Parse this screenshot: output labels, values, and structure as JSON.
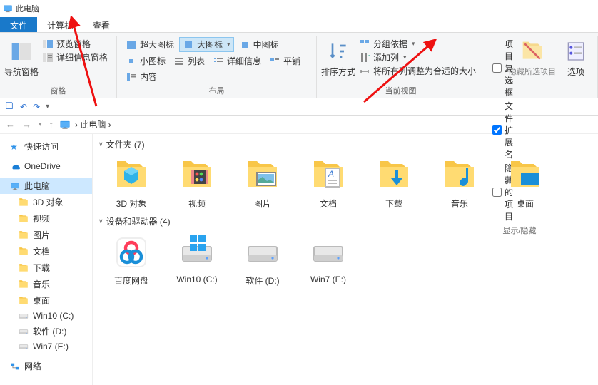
{
  "titlebar": {
    "title": "此电脑"
  },
  "tabs": {
    "file": "文件",
    "computer": "计算机",
    "view": "查看"
  },
  "ribbon": {
    "groups": {
      "panes": {
        "label": "窗格",
        "nav": "导航窗格",
        "preview": "预览窗格",
        "details": "详细信息窗格"
      },
      "layout": {
        "label": "布局",
        "xl": "超大图标",
        "lg": "大图标",
        "md": "中图标",
        "sm": "小图标",
        "list": "列表",
        "det": "详细信息",
        "tile": "平铺",
        "content": "内容"
      },
      "curview": {
        "label": "当前视图",
        "sort": "排序方式",
        "group": "分组依据",
        "addcol": "添加列",
        "fit": "将所有列调整为合适的大小"
      },
      "showhide": {
        "label": "显示/隐藏",
        "itemchk": "项目复选框",
        "ext": "文件扩展名",
        "hidden": "隐藏的项目",
        "hidebtn": "隐藏所选项目"
      },
      "options": {
        "label": "选项"
      }
    }
  },
  "addr": {
    "crumb": "此电脑"
  },
  "sidebar": {
    "quick": "快速访问",
    "onedrive": "OneDrive",
    "thispc": "此电脑",
    "items": {
      "obj3d": "3D 对象",
      "video": "视频",
      "pics": "图片",
      "docs": "文档",
      "dl": "下载",
      "music": "音乐",
      "desktop": "桌面",
      "win10": "Win10 (C:)",
      "soft": "软件 (D:)",
      "win7": "Win7 (E:)"
    },
    "network": "网络"
  },
  "content": {
    "folders_hdr": "文件夹 (7)",
    "drives_hdr": "设备和驱动器 (4)",
    "folders": {
      "obj3d": "3D 对象",
      "video": "视频",
      "pics": "图片",
      "docs": "文档",
      "dl": "下载",
      "music": "音乐",
      "desktop": "桌面"
    },
    "drives": {
      "baidu": "百度网盘",
      "win10": "Win10 (C:)",
      "soft": "软件 (D:)",
      "win7": "Win7 (E:)"
    }
  }
}
